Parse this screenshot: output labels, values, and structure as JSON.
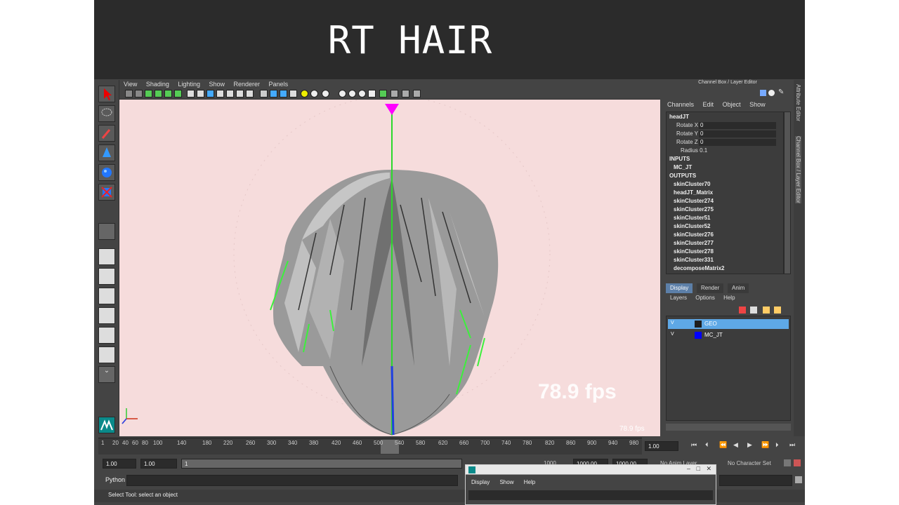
{
  "overlay_title": "RT HAIR",
  "viewport_menu": [
    "View",
    "Shading",
    "Lighting",
    "Show",
    "Renderer",
    "Panels"
  ],
  "viewport": {
    "fps_big": "78.9 fps",
    "fps_small": "78.9 fps"
  },
  "channel_box": {
    "title": "Channel Box / Layer Editor",
    "menu": [
      "Channels",
      "Edit",
      "Object",
      "Show"
    ],
    "node": "headJT",
    "attributes": [
      {
        "label": "Rotate X",
        "value": "0"
      },
      {
        "label": "Rotate Y",
        "value": "0"
      },
      {
        "label": "Rotate Z",
        "value": "0"
      }
    ],
    "radius": "Radius 0.1",
    "inputs_header": "INPUTS",
    "inputs": [
      "MC_JT"
    ],
    "outputs_header": "OUTPUTS",
    "outputs": [
      "skinCluster70",
      "headJT_Matrix",
      "skinCluster274",
      "skinCluster275",
      "skinCluster51",
      "skinCluster52",
      "skinCluster276",
      "skinCluster277",
      "skinCluster278",
      "skinCluster331",
      "decomposeMatrix2"
    ]
  },
  "side_tabs": [
    "Attribute Editor",
    "Channel Box / Layer Editor"
  ],
  "layer_editor": {
    "tabs": [
      "Display",
      "Render",
      "Anim"
    ],
    "menu": [
      "Layers",
      "Options",
      "Help"
    ],
    "layers": [
      {
        "visible": "V",
        "name": "GEO",
        "color": "#1e1e1e",
        "selected": true
      },
      {
        "visible": "V",
        "name": "MC_JT",
        "color": "#0000ff",
        "selected": false
      }
    ]
  },
  "timeline": {
    "ticks": [
      "1",
      "20",
      "40",
      "60",
      "80",
      "100",
      "140",
      "180",
      "220",
      "260",
      "300",
      "340",
      "380",
      "420",
      "460",
      "500",
      "540",
      "580",
      "620",
      "660",
      "700",
      "740",
      "780",
      "820",
      "860",
      "900",
      "940",
      "980"
    ],
    "current_frame": "1.00"
  },
  "range": {
    "start": "1.00",
    "start2": "1.00",
    "slider_start": "1",
    "end_a": "1000",
    "end_b": "1000.00",
    "end_c": "1000.00",
    "anim_layer": "No Anim Layer",
    "character_set": "No Character Set"
  },
  "command_line": {
    "label": "Python"
  },
  "help_line": "Select Tool: select an object",
  "python_window": {
    "menu": [
      "Display",
      "Show",
      "Help"
    ]
  }
}
